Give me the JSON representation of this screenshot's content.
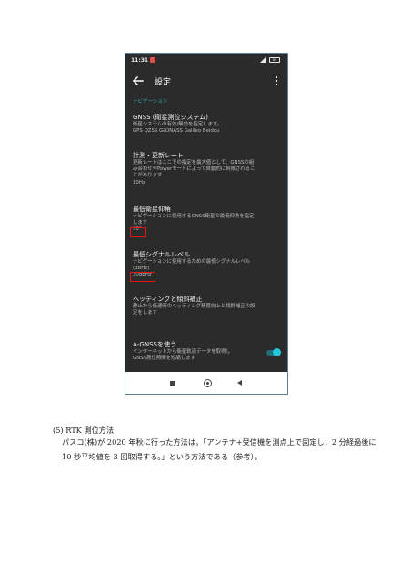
{
  "status_bar": {
    "time": "11:31",
    "battery": "89"
  },
  "app_bar": {
    "title": "設定"
  },
  "section": {
    "header": "ナビゲーション"
  },
  "settings": [
    {
      "title": "GNSS (衛星測位システム)",
      "desc": [
        "衛星システムの有効/無効を指定します。",
        "GPS QZSS GLONASS Galileo Beidou"
      ],
      "value": ""
    },
    {
      "title": "計測・更新レート",
      "desc": [
        "更新レートはここでの指定を最大値として、GNSSの組",
        "み合わせやPowerモードによって自動的に制限されるこ",
        "とがあります"
      ],
      "value": "10Hz"
    },
    {
      "title": "最低衛星仰角",
      "desc": [
        "ナビゲーションに使用するGNSS衛星の最低仰角を指定",
        "します"
      ],
      "value": "30°"
    },
    {
      "title": "最低シグナルレベル",
      "desc": [
        "ナビゲーションに使用するための最低シグナルレベル",
        "(dBHz)"
      ],
      "value": "30dbHz"
    },
    {
      "title": "ヘッディングと傾斜補正",
      "desc": [
        "静止から低速時のヘッディング精度向上と傾斜補正の設",
        "定をします"
      ],
      "value": ""
    },
    {
      "title": "A-GNSSを使う",
      "desc": [
        "インターネットから衛星軌道データを取得し",
        "GNSS測位時間を短縮します"
      ],
      "value": "",
      "toggle_on": true
    }
  ],
  "colors": {
    "accent": "#35a9a9",
    "toggle": "#26c6da",
    "highlight": "#e01818",
    "background": "#2b2b2b"
  },
  "icons": [
    "back-arrow-icon",
    "more-vert-icon",
    "recents-icon",
    "home-icon",
    "back-triangle-icon"
  ],
  "caption": {
    "heading": "(5) RTK 測位方法",
    "body": "パスコ(株)が 2020 年秋に行った方法は，「アンテナ+受信機を測点上で固定し，2 分経過後に 10 秒平均値を 3 回取得する。」という方法である（参考）。"
  }
}
